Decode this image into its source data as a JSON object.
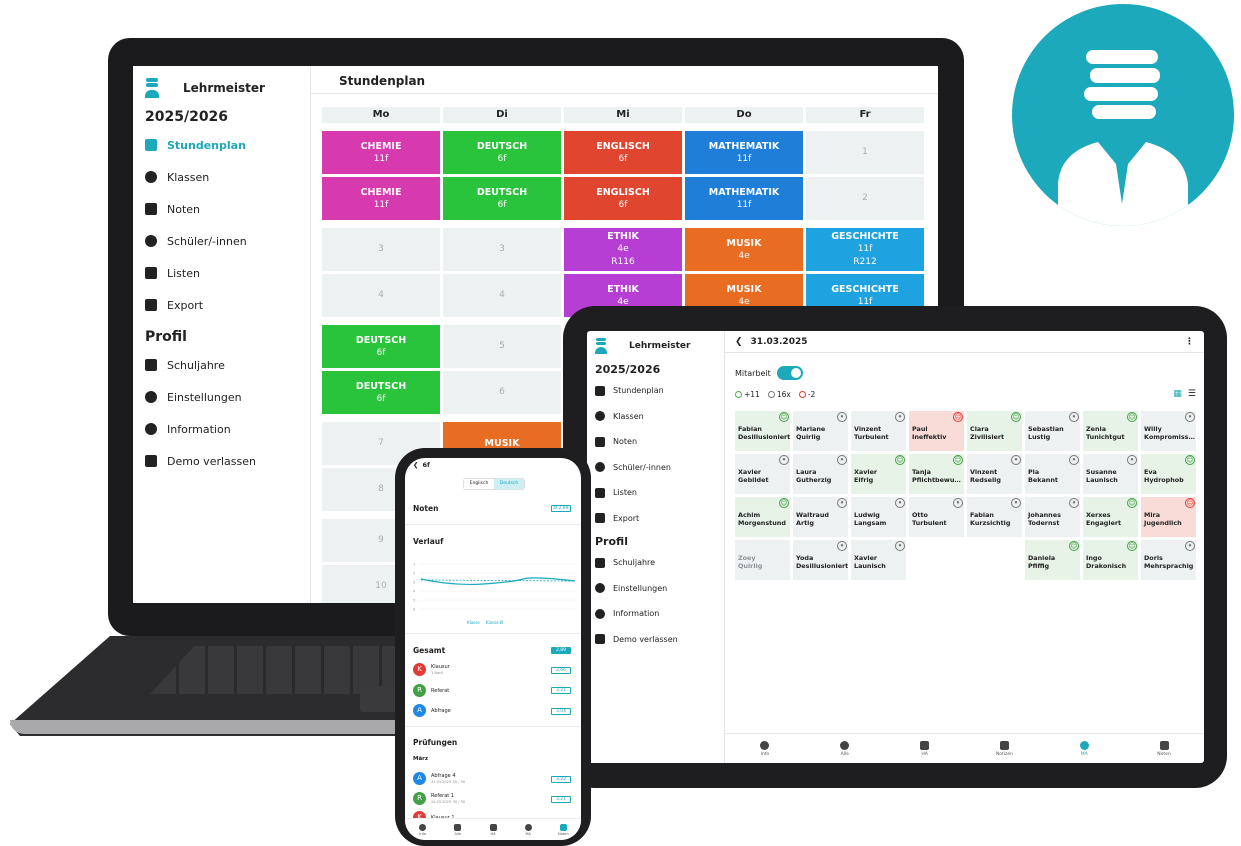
{
  "colors": {
    "accent": "#1ba9bb",
    "chemie": "#d63aae",
    "deutsch": "#2ac43c",
    "englisch": "#e04530",
    "mathematik": "#1f7fd8",
    "ethik": "#b73ed4",
    "musik": "#e86c22",
    "geschichte": "#1ea3e0"
  },
  "laptop": {
    "brand": "Lehrmeister",
    "year": "2025/2026",
    "nav": [
      {
        "label": "Stundenplan",
        "icon": "calendar-icon"
      },
      {
        "label": "Klassen",
        "icon": "group-icon"
      },
      {
        "label": "Noten",
        "icon": "graduation-cap-icon"
      },
      {
        "label": "Schüler/-innen",
        "icon": "person-icon"
      },
      {
        "label": "Listen",
        "icon": "list-icon"
      },
      {
        "label": "Export",
        "icon": "download-icon"
      }
    ],
    "profile_heading": "Profil",
    "profile_nav": [
      {
        "label": "Schuljahre",
        "icon": "archive-icon"
      },
      {
        "label": "Einstellungen",
        "icon": "gear-icon"
      },
      {
        "label": "Information",
        "icon": "info-icon"
      },
      {
        "label": "Demo verlassen",
        "icon": "exit-icon"
      }
    ],
    "header_title": "Stundenplan",
    "days": [
      "Mo",
      "Di",
      "Mi",
      "Do",
      "Fr"
    ],
    "cells": {
      "mo1": {
        "subject": "CHEMIE",
        "class": "11f"
      },
      "mo2": {
        "subject": "CHEMIE",
        "class": "11f"
      },
      "di1": {
        "subject": "DEUTSCH",
        "class": "6f"
      },
      "di2": {
        "subject": "DEUTSCH",
        "class": "6f"
      },
      "mi1": {
        "subject": "ENGLISCH",
        "class": "6f"
      },
      "mi2": {
        "subject": "ENGLISCH",
        "class": "6f"
      },
      "do1": {
        "subject": "MATHEMATIK",
        "class": "11f"
      },
      "do2": {
        "subject": "MATHEMATIK",
        "class": "11f"
      },
      "fr1": "1",
      "fr2": "2",
      "mo3": "3",
      "di3": "3",
      "mo4": "4",
      "di4": "4",
      "mi3": {
        "subject": "ETHIK",
        "class": "4e",
        "room": "R116"
      },
      "mi4": {
        "subject": "ETHIK",
        "class": "4e"
      },
      "do3": {
        "subject": "MUSIK",
        "class": "4e"
      },
      "do4": {
        "subject": "MUSIK",
        "class": "4e"
      },
      "fr3": {
        "subject": "GESCHICHTE",
        "class": "11f",
        "room": "R212"
      },
      "fr4": {
        "subject": "GESCHICHTE",
        "class": "11f"
      },
      "mo5": {
        "subject": "DEUTSCH",
        "class": "6f"
      },
      "mo6": {
        "subject": "DEUTSCH",
        "class": "6f"
      },
      "di5": "5",
      "di6": "6",
      "mo7": "7",
      "mo8": "8",
      "mo9": "9",
      "mo10": "10",
      "di7": {
        "subject": "MUSIK"
      }
    }
  },
  "tablet": {
    "brand": "Lehrmeister",
    "year": "2025/2026",
    "nav": [
      "Stundenplan",
      "Klassen",
      "Noten",
      "Schüler/-innen",
      "Listen",
      "Export"
    ],
    "profile_heading": "Profil",
    "profile_nav": [
      "Schuljahre",
      "Einstellungen",
      "Information",
      "Demo verlassen"
    ],
    "date": "31.03.2025",
    "toggle_label": "Mitarbeit",
    "counts": {
      "plus": "+11",
      "neutral": "16x",
      "minus": "-2"
    },
    "students": [
      {
        "first": "Fabian",
        "last": "Desillusioniert",
        "mood": "g"
      },
      {
        "first": "Mariane",
        "last": "Quirlig",
        "mood": "n"
      },
      {
        "first": "Vinzent",
        "last": "Turbulent",
        "mood": "n"
      },
      {
        "first": "Paul",
        "last": "Ineffektiv",
        "mood": "r"
      },
      {
        "first": "Clara",
        "last": "Zivilisiert",
        "mood": "g"
      },
      {
        "first": "Sebastian",
        "last": "Lustig",
        "mood": "n"
      },
      {
        "first": "Zenia",
        "last": "Tunichtgut",
        "mood": "g"
      },
      {
        "first": "Willy",
        "last": "Kompromiss…",
        "mood": "n"
      },
      {
        "first": "Xavier",
        "last": "Gebildet",
        "mood": "n"
      },
      {
        "first": "Laura",
        "last": "Gutherzig",
        "mood": "n"
      },
      {
        "first": "Xavier",
        "last": "Eifrig",
        "mood": "g"
      },
      {
        "first": "Tanja",
        "last": "Pflichtbewu…",
        "mood": "g"
      },
      {
        "first": "Vinzent",
        "last": "Redselig",
        "mood": "n"
      },
      {
        "first": "Pia",
        "last": "Bekannt",
        "mood": "n"
      },
      {
        "first": "Susanne",
        "last": "Launisch",
        "mood": "n"
      },
      {
        "first": "Eva",
        "last": "Hydrophob",
        "mood": "g"
      },
      {
        "first": "Achim",
        "last": "Morgenstund",
        "mood": "g"
      },
      {
        "first": "Waltraud",
        "last": "Artig",
        "mood": "n"
      },
      {
        "first": "Ludwig",
        "last": "Langsam",
        "mood": "n"
      },
      {
        "first": "Otto",
        "last": "Turbulent",
        "mood": "n"
      },
      {
        "first": "Fabian",
        "last": "Kurzsichtig",
        "mood": "n"
      },
      {
        "first": "Johannes",
        "last": "Todernst",
        "mood": "n"
      },
      {
        "first": "Xerxes",
        "last": "Engagiert",
        "mood": "g"
      },
      {
        "first": "Mira",
        "last": "Jugendlich",
        "mood": "r"
      },
      {
        "first": "Zoey",
        "last": "Quirlig",
        "mood": "none"
      },
      {
        "first": "Yoda",
        "last": "Desillusioniert",
        "mood": "n"
      },
      {
        "first": "Xavier",
        "last": "Launisch",
        "mood": "n"
      },
      {
        "first": "Daniela",
        "last": "Pfiffig",
        "mood": "g"
      },
      {
        "first": "Ingo",
        "last": "Drakonisch",
        "mood": "g"
      },
      {
        "first": "Doris",
        "last": "Mehrsprachig",
        "mood": "n"
      }
    ],
    "bottom_nav": [
      "Info",
      "Alle",
      "HA",
      "Notizen",
      "MA",
      "Noten"
    ]
  },
  "phone": {
    "title": "6f",
    "tabs": [
      "Englisch",
      "Deutsch"
    ],
    "noten_label": "Noten",
    "noten_avg": "Ø 2,89",
    "verlauf_label": "Verlauf",
    "chart_y_ticks": [
      "1",
      "2",
      "3",
      "4",
      "5",
      "6"
    ],
    "legend": [
      "Klasse",
      "Klasse Ø"
    ],
    "gesamt_label": "Gesamt",
    "gesamt_value": "2,89",
    "items": [
      {
        "letter": "K",
        "name": "Klausur",
        "sub": "1 Noch",
        "value": "2,66"
      },
      {
        "letter": "R",
        "name": "Referat",
        "sub": "",
        "value": "3,21"
      },
      {
        "letter": "A",
        "name": "Abfrage",
        "sub": "",
        "value": "3,04"
      }
    ],
    "pruefungen_label": "Prüfungen",
    "month": "März",
    "exams": [
      {
        "letter": "A",
        "name": "Abfrage 4",
        "date": "31.03.2025",
        "count": "30 / 30",
        "value": "3,22"
      },
      {
        "letter": "R",
        "name": "Referat 1",
        "date": "20.03.2025",
        "count": "30 / 30",
        "value": "3,21"
      },
      {
        "letter": "K",
        "name": "Klausur 1",
        "date": "",
        "count": "",
        "value": ""
      }
    ],
    "bottom_nav": [
      "Info",
      "Alle",
      "HA",
      "MA",
      "Noten"
    ]
  }
}
